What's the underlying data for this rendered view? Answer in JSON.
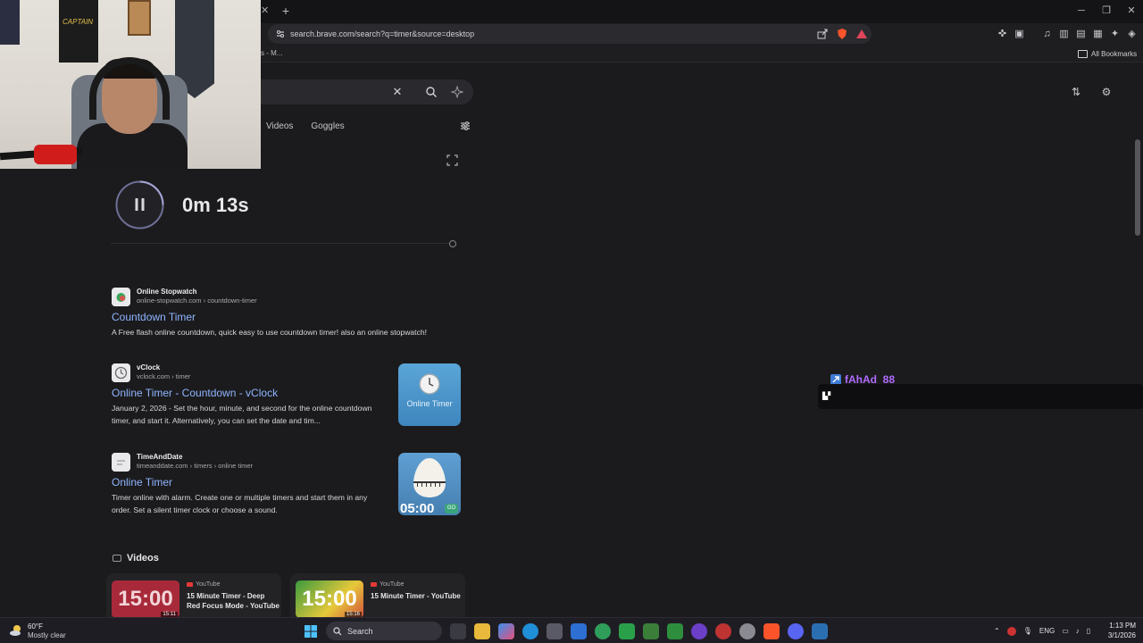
{
  "browser": {
    "url": "search.brave.com/search?q=timer&source=desktop",
    "bookmark_fragment": "s - M...",
    "all_bookmarks_label": "All Bookmarks"
  },
  "search": {
    "tabs": [
      "Videos",
      "Goggles"
    ]
  },
  "timer": {
    "value": "0m 13s",
    "state": "running"
  },
  "results": [
    {
      "site_name": "Online Stopwatch",
      "site_url": "online-stopwatch.com › countdown-timer",
      "title": "Countdown Timer",
      "snippet": "A Free flash online countdown, quick easy to use countdown timer! also an online stopwatch!"
    },
    {
      "site_name": "vClock",
      "site_url": "vclock.com › timer",
      "title": "Online Timer - Countdown - vClock",
      "snippet": "January 2, 2026 - Set the hour, minute, and second for the online countdown timer, and start it. Alternatively, you can set the date and tim...",
      "thumb_caption": "Online Timer"
    },
    {
      "site_name": "TimeAndDate",
      "site_url": "timeanddate.com › timers › online timer",
      "title": "Online Timer",
      "snippet": "Timer online with alarm. Create one or multiple timers and start them in any order. Set a silent timer clock or choose a sound.",
      "thumb_caption": "05:00",
      "thumb_badge": "GO"
    }
  ],
  "videos": {
    "header": "Videos",
    "items": [
      {
        "source": "YouTube",
        "title": "15 Minute Timer - Deep Red Focus Mode - YouTube",
        "thumb_text": "15:00",
        "duration": "15:11"
      },
      {
        "source": "YouTube",
        "title": "15 Minute Timer - YouTube",
        "thumb_text": "15:00",
        "duration": "15:16"
      }
    ]
  },
  "stream_overlay": {
    "username": "fAhAd_88",
    "username_color": "#b06bff"
  },
  "webcam": {
    "poster_text": "CAPTAIN"
  },
  "taskbar": {
    "weather_temp": "60°F",
    "weather_condition": "Mostly clear",
    "search_label": "Search",
    "language": "ENG",
    "time": "1:13 PM",
    "date": "3/1/2026"
  },
  "colors": {
    "link": "#8fb4ff",
    "background": "#1b1b1d",
    "accent_brave": "#fb542b"
  }
}
